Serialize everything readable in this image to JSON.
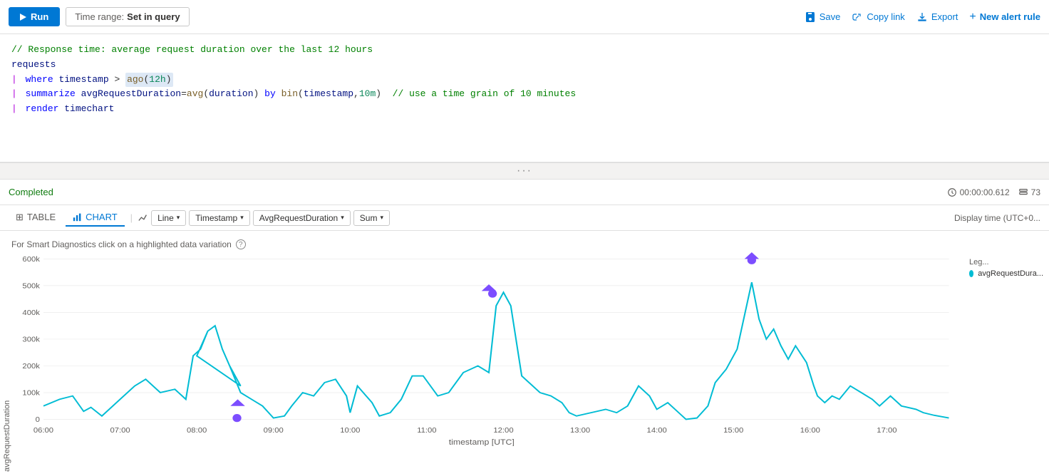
{
  "toolbar": {
    "run_label": "Run",
    "time_range_label": "Time range:",
    "time_range_value": "Set in query",
    "save_label": "Save",
    "copy_link_label": "Copy link",
    "export_label": "Export",
    "new_alert_label": "New alert rule"
  },
  "query": {
    "comment": "// Response time: average request duration over the last 12 hours",
    "line1": "requests",
    "line2_pipe": "|",
    "line2_keyword": "where",
    "line2_field": "timestamp",
    "line2_op": ">",
    "line2_fn": "ago",
    "line2_arg": "12h",
    "line3_pipe": "|",
    "line3_keyword": "summarize",
    "line3_expr": "avgRequestDuration=avg(duration)",
    "line3_by": "by",
    "line3_fn2": "bin",
    "line3_args": "timestamp, 10m",
    "line3_comment": "// use a time grain of 10 minutes",
    "line4_pipe": "|",
    "line4_keyword": "render",
    "line4_value": "timechart"
  },
  "results": {
    "status": "Completed",
    "duration": "00:00:00.612",
    "row_count": "73"
  },
  "chart_toolbar": {
    "table_label": "TABLE",
    "chart_label": "CHART",
    "line_label": "Line",
    "timestamp_label": "Timestamp",
    "avg_label": "AvgRequestDuration",
    "sum_label": "Sum",
    "display_time": "Display time (UTC+0..."
  },
  "chart": {
    "smart_diag": "For Smart Diagnostics click on a highlighted data variation",
    "y_label": "avgRequestDuration",
    "x_label": "timestamp [UTC]",
    "y_ticks": [
      "600k",
      "500k",
      "400k",
      "300k",
      "200k",
      "100k",
      "0"
    ],
    "x_ticks": [
      "06:00",
      "07:00",
      "08:00",
      "09:00",
      "10:00",
      "11:00",
      "12:00",
      "13:00",
      "14:00",
      "15:00",
      "16:00",
      "17:00"
    ],
    "legend_label": "Leg...",
    "legend_series": "avgRequestDura..."
  }
}
